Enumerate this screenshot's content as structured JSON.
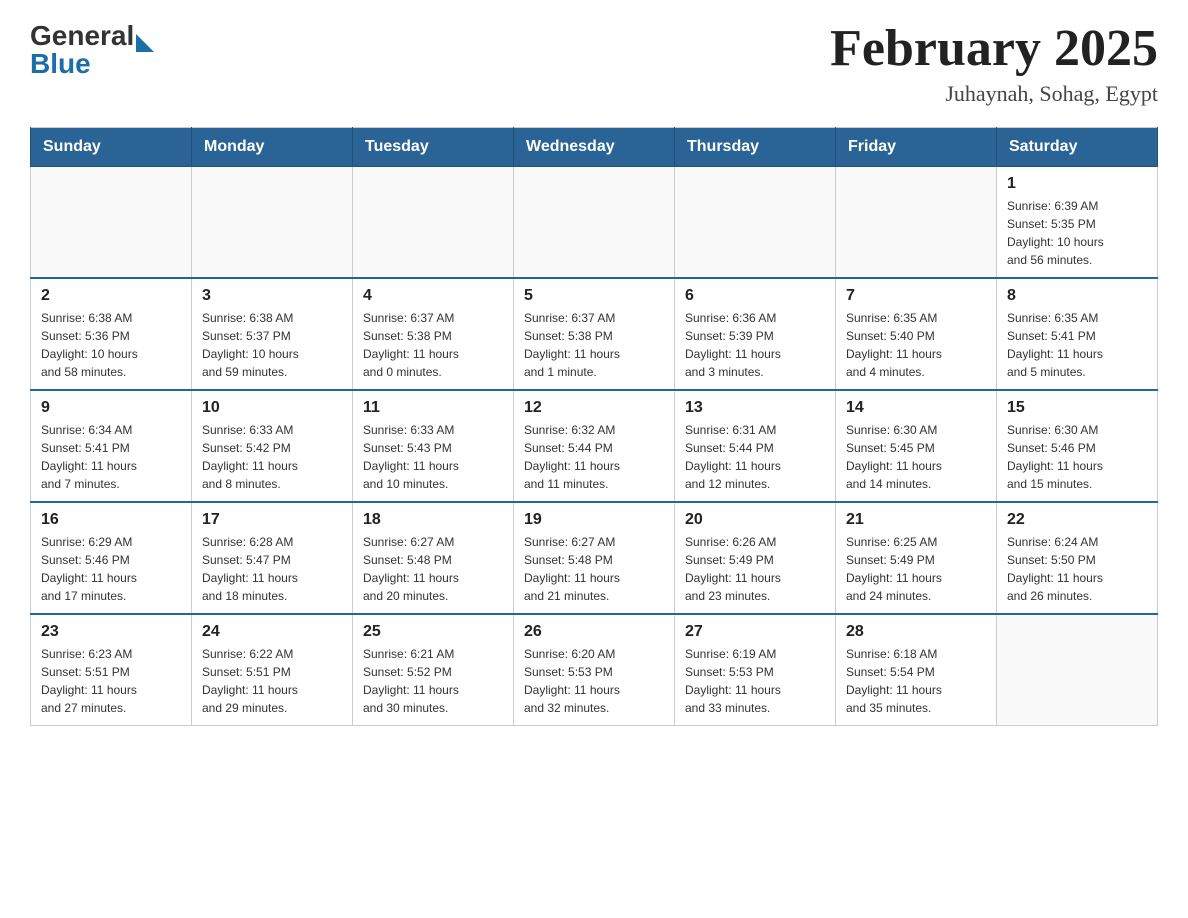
{
  "header": {
    "logo_general": "General",
    "logo_blue": "Blue",
    "month_title": "February 2025",
    "location": "Juhaynah, Sohag, Egypt"
  },
  "days_of_week": [
    "Sunday",
    "Monday",
    "Tuesday",
    "Wednesday",
    "Thursday",
    "Friday",
    "Saturday"
  ],
  "weeks": [
    {
      "days": [
        {
          "number": "",
          "info": ""
        },
        {
          "number": "",
          "info": ""
        },
        {
          "number": "",
          "info": ""
        },
        {
          "number": "",
          "info": ""
        },
        {
          "number": "",
          "info": ""
        },
        {
          "number": "",
          "info": ""
        },
        {
          "number": "1",
          "info": "Sunrise: 6:39 AM\nSunset: 5:35 PM\nDaylight: 10 hours\nand 56 minutes."
        }
      ]
    },
    {
      "days": [
        {
          "number": "2",
          "info": "Sunrise: 6:38 AM\nSunset: 5:36 PM\nDaylight: 10 hours\nand 58 minutes."
        },
        {
          "number": "3",
          "info": "Sunrise: 6:38 AM\nSunset: 5:37 PM\nDaylight: 10 hours\nand 59 minutes."
        },
        {
          "number": "4",
          "info": "Sunrise: 6:37 AM\nSunset: 5:38 PM\nDaylight: 11 hours\nand 0 minutes."
        },
        {
          "number": "5",
          "info": "Sunrise: 6:37 AM\nSunset: 5:38 PM\nDaylight: 11 hours\nand 1 minute."
        },
        {
          "number": "6",
          "info": "Sunrise: 6:36 AM\nSunset: 5:39 PM\nDaylight: 11 hours\nand 3 minutes."
        },
        {
          "number": "7",
          "info": "Sunrise: 6:35 AM\nSunset: 5:40 PM\nDaylight: 11 hours\nand 4 minutes."
        },
        {
          "number": "8",
          "info": "Sunrise: 6:35 AM\nSunset: 5:41 PM\nDaylight: 11 hours\nand 5 minutes."
        }
      ]
    },
    {
      "days": [
        {
          "number": "9",
          "info": "Sunrise: 6:34 AM\nSunset: 5:41 PM\nDaylight: 11 hours\nand 7 minutes."
        },
        {
          "number": "10",
          "info": "Sunrise: 6:33 AM\nSunset: 5:42 PM\nDaylight: 11 hours\nand 8 minutes."
        },
        {
          "number": "11",
          "info": "Sunrise: 6:33 AM\nSunset: 5:43 PM\nDaylight: 11 hours\nand 10 minutes."
        },
        {
          "number": "12",
          "info": "Sunrise: 6:32 AM\nSunset: 5:44 PM\nDaylight: 11 hours\nand 11 minutes."
        },
        {
          "number": "13",
          "info": "Sunrise: 6:31 AM\nSunset: 5:44 PM\nDaylight: 11 hours\nand 12 minutes."
        },
        {
          "number": "14",
          "info": "Sunrise: 6:30 AM\nSunset: 5:45 PM\nDaylight: 11 hours\nand 14 minutes."
        },
        {
          "number": "15",
          "info": "Sunrise: 6:30 AM\nSunset: 5:46 PM\nDaylight: 11 hours\nand 15 minutes."
        }
      ]
    },
    {
      "days": [
        {
          "number": "16",
          "info": "Sunrise: 6:29 AM\nSunset: 5:46 PM\nDaylight: 11 hours\nand 17 minutes."
        },
        {
          "number": "17",
          "info": "Sunrise: 6:28 AM\nSunset: 5:47 PM\nDaylight: 11 hours\nand 18 minutes."
        },
        {
          "number": "18",
          "info": "Sunrise: 6:27 AM\nSunset: 5:48 PM\nDaylight: 11 hours\nand 20 minutes."
        },
        {
          "number": "19",
          "info": "Sunrise: 6:27 AM\nSunset: 5:48 PM\nDaylight: 11 hours\nand 21 minutes."
        },
        {
          "number": "20",
          "info": "Sunrise: 6:26 AM\nSunset: 5:49 PM\nDaylight: 11 hours\nand 23 minutes."
        },
        {
          "number": "21",
          "info": "Sunrise: 6:25 AM\nSunset: 5:49 PM\nDaylight: 11 hours\nand 24 minutes."
        },
        {
          "number": "22",
          "info": "Sunrise: 6:24 AM\nSunset: 5:50 PM\nDaylight: 11 hours\nand 26 minutes."
        }
      ]
    },
    {
      "days": [
        {
          "number": "23",
          "info": "Sunrise: 6:23 AM\nSunset: 5:51 PM\nDaylight: 11 hours\nand 27 minutes."
        },
        {
          "number": "24",
          "info": "Sunrise: 6:22 AM\nSunset: 5:51 PM\nDaylight: 11 hours\nand 29 minutes."
        },
        {
          "number": "25",
          "info": "Sunrise: 6:21 AM\nSunset: 5:52 PM\nDaylight: 11 hours\nand 30 minutes."
        },
        {
          "number": "26",
          "info": "Sunrise: 6:20 AM\nSunset: 5:53 PM\nDaylight: 11 hours\nand 32 minutes."
        },
        {
          "number": "27",
          "info": "Sunrise: 6:19 AM\nSunset: 5:53 PM\nDaylight: 11 hours\nand 33 minutes."
        },
        {
          "number": "28",
          "info": "Sunrise: 6:18 AM\nSunset: 5:54 PM\nDaylight: 11 hours\nand 35 minutes."
        },
        {
          "number": "",
          "info": ""
        }
      ]
    }
  ]
}
